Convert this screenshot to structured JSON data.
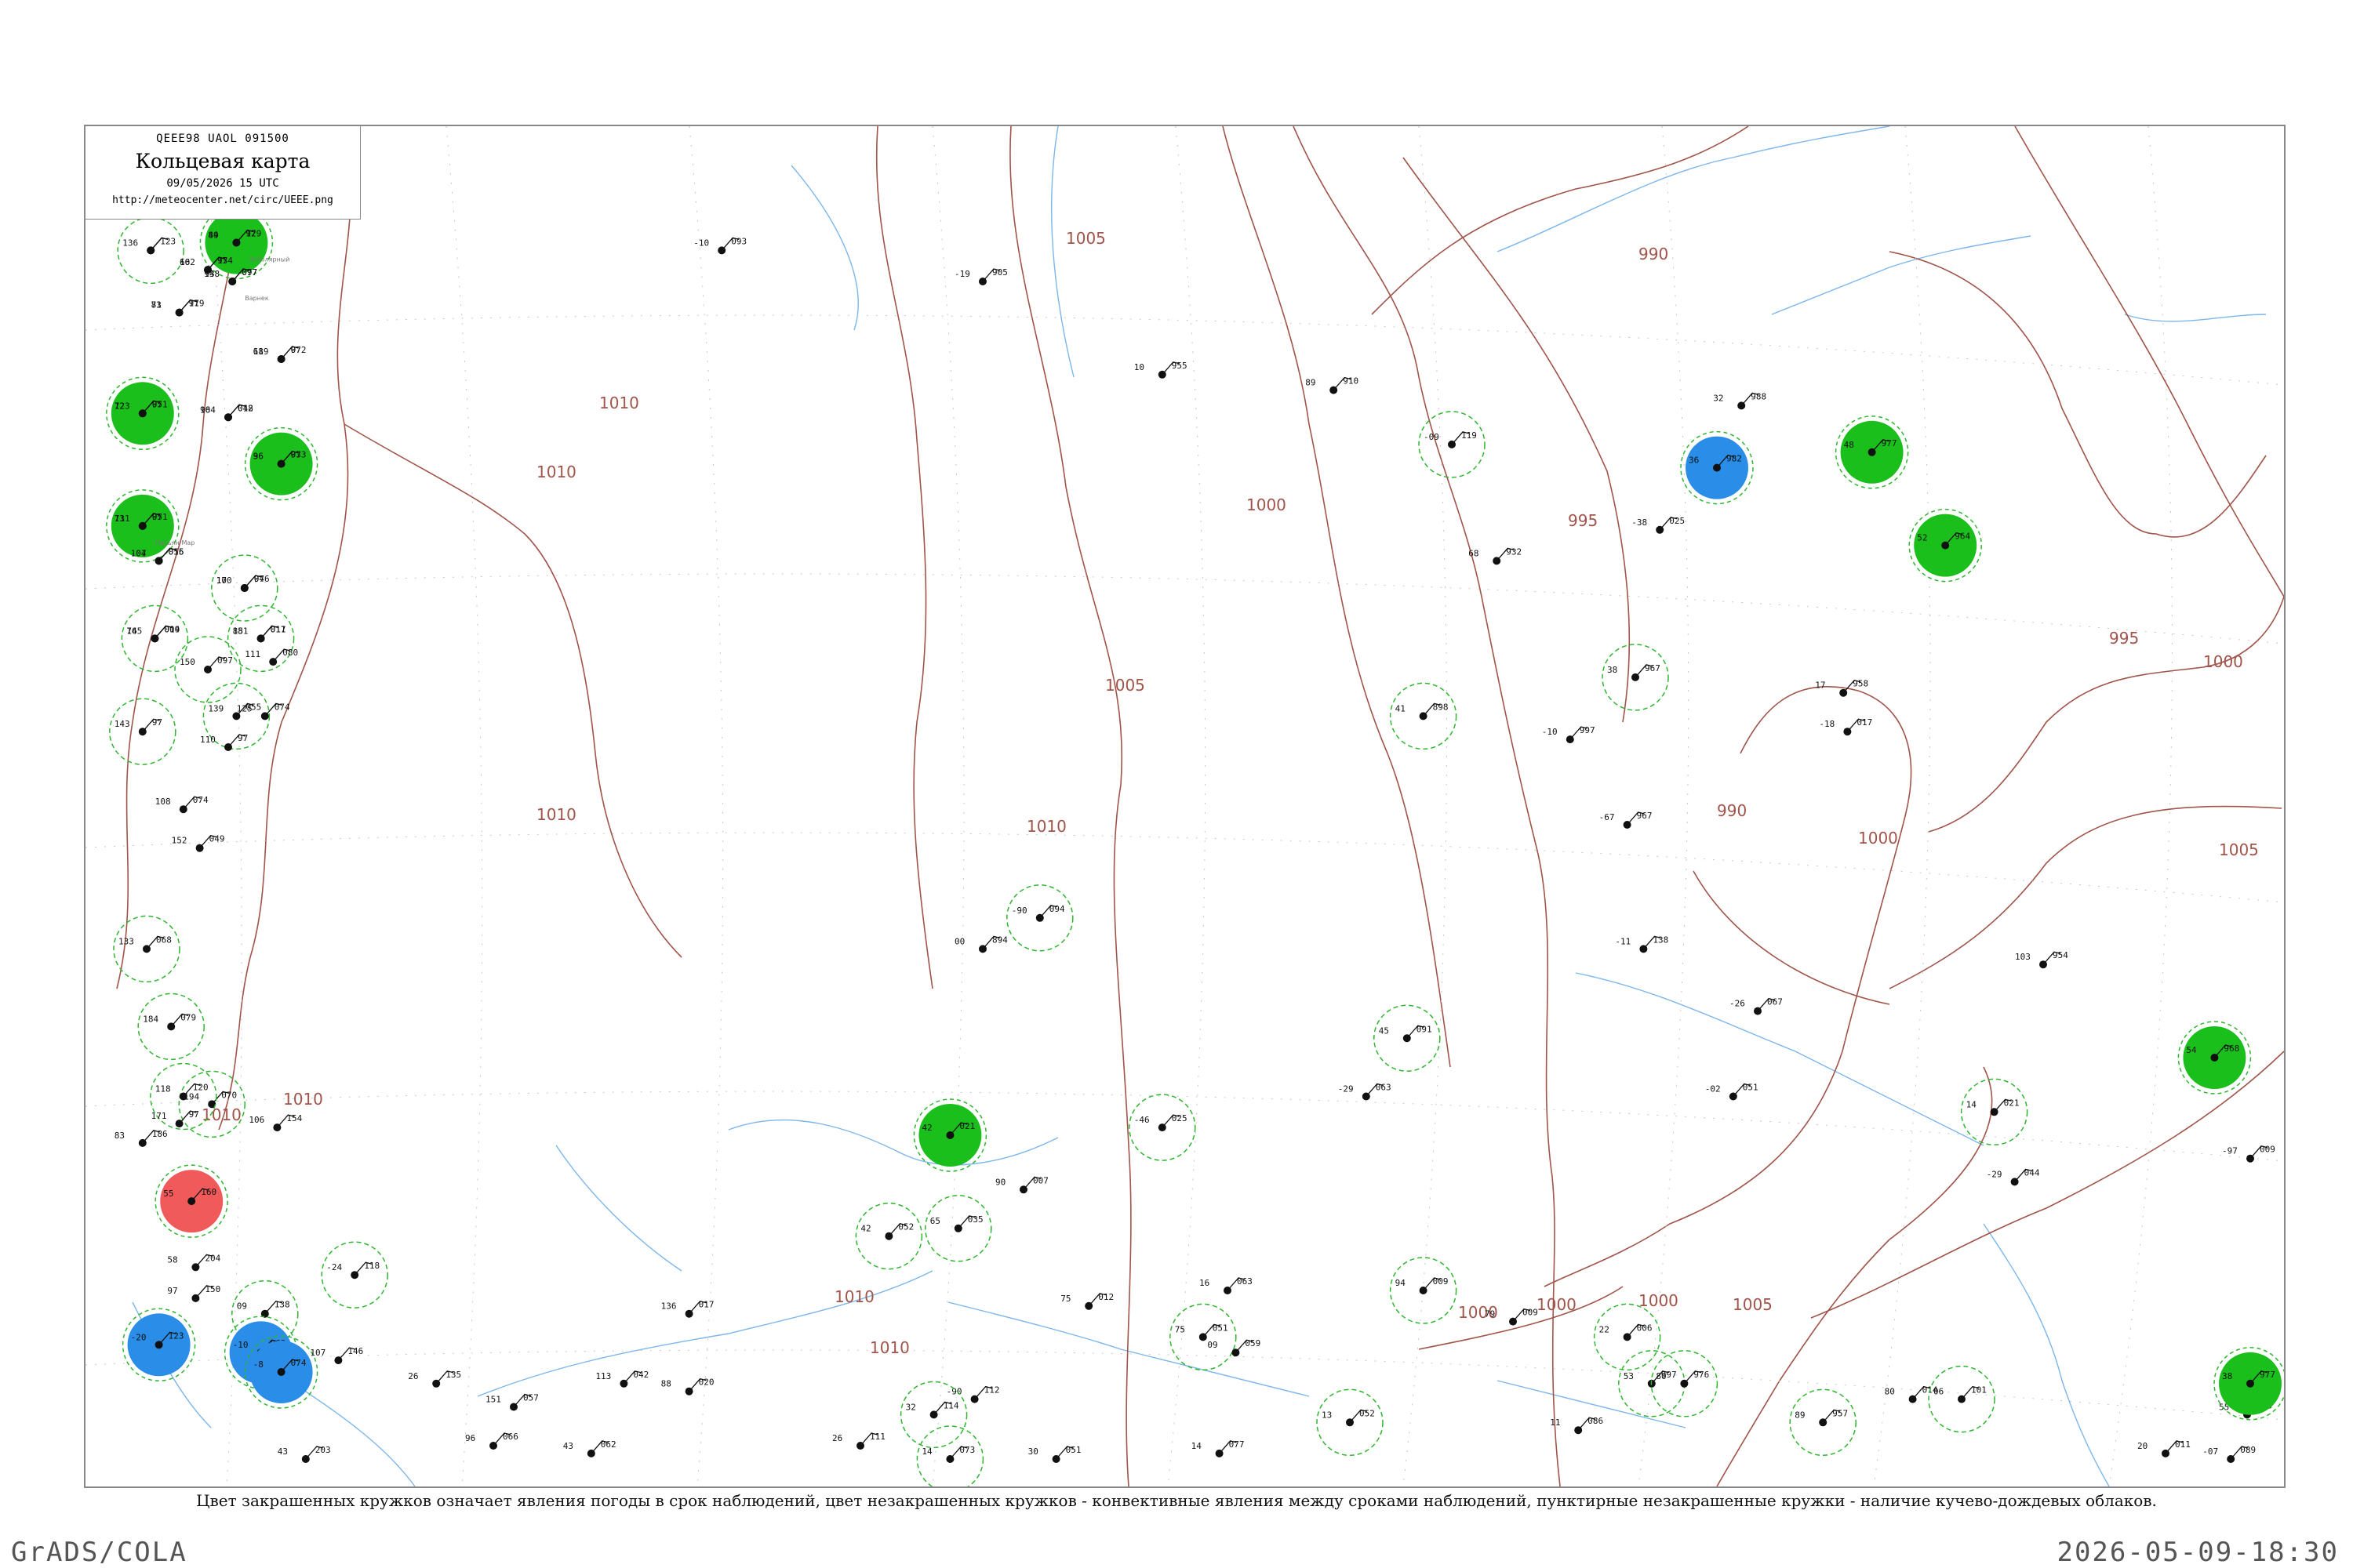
{
  "header": {
    "code_line": "QEEE98  UAOL  091500",
    "title": "Кольцевая карта",
    "time": "09/05/2026 15 UTC",
    "url": "http://meteocenter.net/circ/UEEE.png"
  },
  "caption": "Цвет закрашенных кружков означает явления погоды в срок наблюдений, цвет незакрашенных кружков - конвективные явления между сроками наблюдений, пунктирные незакрашенные кружки - наличие кучево-дождевых облаков.",
  "footer": {
    "left": "GrADS/COLA",
    "right": "2026-05-09-18:30"
  },
  "colors": {
    "isobar": "#a0544a",
    "river": "#7cb6ea",
    "station_green": "#1bbf1b",
    "station_blue": "#2a8de8",
    "station_red": "#f05a5a",
    "ring_green": "#2fb62f"
  },
  "isobar_labels": [
    {
      "text": "1010"
    },
    {
      "text": "1010"
    },
    {
      "text": "1010"
    },
    {
      "text": "1010"
    },
    {
      "text": "1010"
    },
    {
      "text": "1010"
    },
    {
      "text": "1010"
    },
    {
      "text": "1005"
    },
    {
      "text": "1005"
    },
    {
      "text": "1000"
    },
    {
      "text": "1000"
    },
    {
      "text": "995"
    },
    {
      "text": "990"
    },
    {
      "text": "995"
    },
    {
      "text": "1000"
    },
    {
      "text": "990"
    },
    {
      "text": "1000"
    },
    {
      "text": "1005"
    },
    {
      "text": "1000"
    },
    {
      "text": "1000"
    },
    {
      "text": "1005"
    },
    {
      "text": "1010"
    }
  ],
  "stations": [
    {
      "kind": "ring",
      "top": "",
      "bottom": "",
      "name": ""
    },
    {
      "kind": "green",
      "top": "44",
      "bottom": "97",
      "name": "Заполярный"
    },
    {
      "kind": "plain",
      "top": "102",
      "bottom": "97",
      "name": ""
    },
    {
      "kind": "plain",
      "top": "94",
      "bottom": "097",
      "name": "Варнек"
    },
    {
      "kind": "plain",
      "top": "81",
      "bottom": "97",
      "name": ""
    },
    {
      "kind": "plain",
      "top": "68",
      "bottom": "97",
      "name": ""
    },
    {
      "kind": "green",
      "top": "72",
      "bottom": "97",
      "name": ""
    },
    {
      "kind": "plain",
      "top": "96",
      "bottom": "012",
      "name": ""
    },
    {
      "kind": "green",
      "top": "73",
      "bottom": "97",
      "name": "Нарьян-Мар"
    },
    {
      "kind": "green",
      "top": "96",
      "bottom": "97",
      "name": ""
    },
    {
      "kind": "ring",
      "top": "100",
      "bottom": "97",
      "name": ""
    },
    {
      "kind": "plain",
      "top": "104",
      "bottom": "056",
      "name": ""
    },
    {
      "kind": "ring",
      "top": "145",
      "bottom": "009",
      "name": ""
    },
    {
      "kind": "ring",
      "top": "151",
      "bottom": "017",
      "name": ""
    },
    {
      "kind": "plain",
      "top": "111",
      "bottom": "080",
      "name": ""
    },
    {
      "kind": "ring",
      "top": "143",
      "bottom": "97",
      "name": ""
    },
    {
      "kind": "ring",
      "top": "150",
      "bottom": "097",
      "name": ""
    },
    {
      "kind": "ring",
      "top": "139",
      "bottom": "055",
      "name": ""
    },
    {
      "kind": "plain",
      "top": "125",
      "bottom": "074",
      "name": ""
    },
    {
      "kind": "plain",
      "top": "110",
      "bottom": "97",
      "name": ""
    },
    {
      "kind": "plain",
      "top": "108",
      "bottom": "074",
      "name": ""
    },
    {
      "kind": "plain",
      "top": "152",
      "bottom": "049",
      "name": ""
    },
    {
      "kind": "ring",
      "top": "133",
      "bottom": "068",
      "name": ""
    },
    {
      "kind": "ring",
      "top": "184",
      "bottom": "079",
      "name": ""
    },
    {
      "kind": "ring",
      "top": "194",
      "bottom": "070",
      "name": ""
    },
    {
      "kind": "ring",
      "top": "118",
      "bottom": "120",
      "name": ""
    },
    {
      "kind": "plain",
      "top": "171",
      "bottom": "97",
      "name": ""
    },
    {
      "kind": "plain",
      "top": "106",
      "bottom": "154",
      "name": ""
    },
    {
      "kind": "plain",
      "top": "83",
      "bottom": "186",
      "name": ""
    },
    {
      "kind": "red",
      "top": "55",
      "bottom": "160",
      "name": ""
    },
    {
      "kind": "plain",
      "top": "58",
      "bottom": "204",
      "name": ""
    },
    {
      "kind": "plain",
      "top": "97",
      "bottom": "150",
      "name": ""
    },
    {
      "kind": "ring",
      "top": "09",
      "bottom": "138",
      "name": ""
    },
    {
      "kind": "ring",
      "top": "-24",
      "bottom": "118",
      "name": ""
    },
    {
      "kind": "blue",
      "top": "-20",
      "bottom": "123",
      "name": ""
    },
    {
      "kind": "blue",
      "top": "-10",
      "bottom": "063",
      "name": ""
    },
    {
      "kind": "blue",
      "top": "-8",
      "bottom": "074",
      "name": ""
    },
    {
      "kind": "plain",
      "top": "151",
      "bottom": "057",
      "name": ""
    },
    {
      "kind": "plain",
      "top": "-10",
      "bottom": "093",
      "name": ""
    },
    {
      "kind": "plain",
      "top": "-19",
      "bottom": "905",
      "name": ""
    },
    {
      "kind": "plain",
      "top": "00",
      "bottom": "894",
      "name": ""
    },
    {
      "kind": "plain",
      "top": "10",
      "bottom": "955",
      "name": ""
    },
    {
      "kind": "plain",
      "top": "89",
      "bottom": "910",
      "name": ""
    },
    {
      "kind": "ring",
      "top": "-09",
      "bottom": "119",
      "name": ""
    },
    {
      "kind": "plain",
      "top": "-38",
      "bottom": "025",
      "name": ""
    },
    {
      "kind": "ring",
      "top": "38",
      "bottom": "967",
      "name": ""
    },
    {
      "kind": "ring",
      "top": "41",
      "bottom": "898",
      "name": ""
    },
    {
      "kind": "plain",
      "top": "68",
      "bottom": "932",
      "name": ""
    },
    {
      "kind": "plain",
      "top": "32",
      "bottom": "988",
      "name": ""
    },
    {
      "kind": "blue",
      "top": "36",
      "bottom": "982",
      "name": ""
    },
    {
      "kind": "green",
      "top": "48",
      "bottom": "977",
      "name": ""
    },
    {
      "kind": "green",
      "top": "52",
      "bottom": "964",
      "name": ""
    },
    {
      "kind": "plain",
      "top": "17",
      "bottom": "958",
      "name": ""
    },
    {
      "kind": "plain",
      "top": "-18",
      "bottom": "017",
      "name": ""
    },
    {
      "kind": "plain",
      "top": "-10",
      "bottom": "997",
      "name": ""
    },
    {
      "kind": "ring",
      "top": "-90",
      "bottom": "094",
      "name": ""
    },
    {
      "kind": "plain",
      "top": "-11",
      "bottom": "138",
      "name": ""
    },
    {
      "kind": "plain",
      "top": "-26",
      "bottom": "067",
      "name": ""
    },
    {
      "kind": "plain",
      "top": "-02",
      "bottom": "051",
      "name": ""
    },
    {
      "kind": "ring",
      "top": "14",
      "bottom": "021",
      "name": ""
    },
    {
      "kind": "plain",
      "top": "-29",
      "bottom": "044",
      "name": ""
    },
    {
      "kind": "plain",
      "top": "-97",
      "bottom": "009",
      "name": ""
    },
    {
      "kind": "plain",
      "top": "55",
      "bottom": "958",
      "name": ""
    },
    {
      "kind": "green",
      "top": "38",
      "bottom": "977",
      "name": ""
    },
    {
      "kind": "green",
      "top": "54",
      "bottom": "968",
      "name": ""
    },
    {
      "kind": "plain",
      "top": "103",
      "bottom": "954",
      "name": ""
    },
    {
      "kind": "plain",
      "top": "-67",
      "bottom": "967",
      "name": ""
    },
    {
      "kind": "ring",
      "top": "45",
      "bottom": "091",
      "name": ""
    },
    {
      "kind": "plain",
      "top": "-29",
      "bottom": "063",
      "name": ""
    },
    {
      "kind": "ring",
      "top": "-46",
      "bottom": "025",
      "name": ""
    },
    {
      "kind": "green",
      "top": "42",
      "bottom": "021",
      "name": ""
    },
    {
      "kind": "ring",
      "top": "65",
      "bottom": "035",
      "name": ""
    },
    {
      "kind": "ring",
      "top": "42",
      "bottom": "052",
      "name": ""
    },
    {
      "kind": "plain",
      "top": "-90",
      "bottom": "112",
      "name": ""
    },
    {
      "kind": "ring",
      "top": "32",
      "bottom": "114",
      "name": ""
    },
    {
      "kind": "plain",
      "top": "26",
      "bottom": "111",
      "name": ""
    },
    {
      "kind": "ring",
      "top": "75",
      "bottom": "051",
      "name": ""
    },
    {
      "kind": "ring",
      "top": "94",
      "bottom": "009",
      "name": ""
    },
    {
      "kind": "plain",
      "top": "79",
      "bottom": "009",
      "name": ""
    },
    {
      "kind": "ring",
      "top": "22",
      "bottom": "006",
      "name": ""
    },
    {
      "kind": "ring",
      "top": "53",
      "bottom": "997",
      "name": ""
    },
    {
      "kind": "ring",
      "top": "80",
      "bottom": "976",
      "name": ""
    },
    {
      "kind": "ring",
      "top": "89",
      "bottom": "957",
      "name": ""
    },
    {
      "kind": "plain",
      "top": "80",
      "bottom": "014",
      "name": ""
    },
    {
      "kind": "ring",
      "top": "06",
      "bottom": "101",
      "name": ""
    },
    {
      "kind": "plain",
      "top": "-07",
      "bottom": "089",
      "name": ""
    },
    {
      "kind": "plain",
      "top": "20",
      "bottom": "011",
      "name": ""
    },
    {
      "kind": "plain",
      "top": "11",
      "bottom": "086",
      "name": ""
    },
    {
      "kind": "ring",
      "top": "13",
      "bottom": "052",
      "name": ""
    },
    {
      "kind": "plain",
      "top": "14",
      "bottom": "077",
      "name": ""
    },
    {
      "kind": "ring",
      "top": "14",
      "bottom": "073",
      "name": ""
    },
    {
      "kind": "plain",
      "top": "30",
      "bottom": "051",
      "name": ""
    },
    {
      "kind": "plain",
      "top": "09",
      "bottom": "059",
      "name": ""
    },
    {
      "kind": "plain",
      "top": "16",
      "bottom": "063",
      "name": ""
    },
    {
      "kind": "plain",
      "top": "75",
      "bottom": "012",
      "name": ""
    },
    {
      "kind": "plain",
      "top": "90",
      "bottom": "007",
      "name": ""
    },
    {
      "kind": "plain",
      "top": "136",
      "bottom": "017",
      "name": ""
    },
    {
      "kind": "plain",
      "top": "88",
      "bottom": "020",
      "name": ""
    },
    {
      "kind": "plain",
      "top": "113",
      "bottom": "042",
      "name": ""
    },
    {
      "kind": "plain",
      "top": "43",
      "bottom": "062",
      "name": ""
    },
    {
      "kind": "plain",
      "top": "96",
      "bottom": "066",
      "name": ""
    },
    {
      "kind": "plain",
      "top": "26",
      "bottom": "135",
      "name": ""
    },
    {
      "kind": "plain",
      "top": "107",
      "bottom": "146",
      "name": ""
    },
    {
      "kind": "plain",
      "top": "43",
      "bottom": "203",
      "name": ""
    },
    {
      "kind": "plain",
      "top": "136",
      "bottom": "123",
      "name": ""
    },
    {
      "kind": "plain",
      "top": "89",
      "bottom": "129",
      "name": ""
    },
    {
      "kind": "plain",
      "top": "66",
      "bottom": "134",
      "name": ""
    },
    {
      "kind": "plain",
      "top": "138",
      "bottom": "077",
      "name": ""
    },
    {
      "kind": "plain",
      "top": "73",
      "bottom": "119",
      "name": ""
    },
    {
      "kind": "plain",
      "top": "119",
      "bottom": "072",
      "name": ""
    },
    {
      "kind": "plain",
      "top": "123",
      "bottom": "051",
      "name": ""
    },
    {
      "kind": "plain",
      "top": "104",
      "bottom": "048",
      "name": ""
    },
    {
      "kind": "plain",
      "top": "111",
      "bottom": "051",
      "name": ""
    },
    {
      "kind": "plain",
      "top": "36",
      "bottom": "033",
      "name": ""
    },
    {
      "kind": "plain",
      "top": "17",
      "bottom": "046",
      "name": ""
    },
    {
      "kind": "plain",
      "top": "-07",
      "bottom": "015",
      "name": ""
    },
    {
      "kind": "plain",
      "top": "76",
      "bottom": "014",
      "name": ""
    },
    {
      "kind": "plain",
      "top": "88",
      "bottom": "011",
      "name": ""
    }
  ]
}
